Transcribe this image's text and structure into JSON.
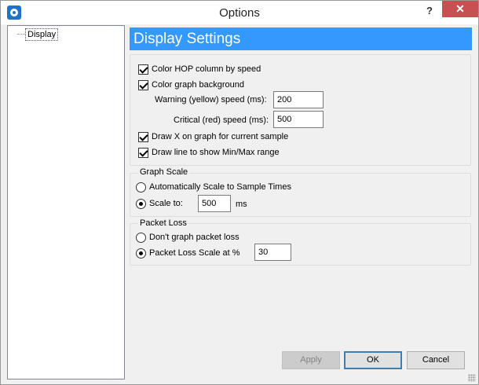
{
  "window": {
    "title": "Options",
    "help": "?",
    "close": "✕"
  },
  "tree": {
    "items": [
      {
        "label": "Display"
      }
    ]
  },
  "display": {
    "header": "Display Settings",
    "color_hop": {
      "label": "Color HOP column by speed",
      "checked": true
    },
    "color_graph": {
      "label": "Color graph background",
      "checked": true
    },
    "warning_label": "Warning (yellow) speed (ms):",
    "warning_value": "200",
    "critical_label": "Critical (red) speed (ms):",
    "critical_value": "500",
    "draw_x": {
      "label": "Draw X on graph for current sample",
      "checked": true
    },
    "draw_line": {
      "label": "Draw line to show Min/Max range",
      "checked": true
    }
  },
  "graph_scale": {
    "title": "Graph Scale",
    "auto": {
      "label": "Automatically Scale to Sample Times",
      "selected": false
    },
    "scale_to": {
      "label": "Scale to:",
      "selected": true
    },
    "scale_value": "500",
    "unit": "ms"
  },
  "packet_loss": {
    "title": "Packet Loss",
    "dont_graph": {
      "label": "Don't graph packet loss",
      "selected": false
    },
    "scale_at": {
      "label": "Packet Loss Scale at %",
      "selected": true
    },
    "scale_value": "30"
  },
  "buttons": {
    "apply": "Apply",
    "ok": "OK",
    "cancel": "Cancel"
  }
}
